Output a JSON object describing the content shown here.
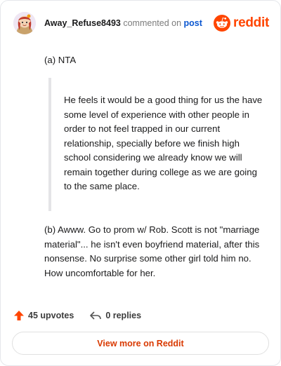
{
  "header": {
    "username": "Away_Refuse8493",
    "verb": "commented on",
    "post_link": "post",
    "brand_name": "reddit"
  },
  "comment": {
    "para_a": "(a) NTA",
    "quote": "He feels it would be a good thing for us the have some level of experience with other people in order to not feel trapped in our current relationship, specially before we finish high school considering we already know we will remain together during college as we are going to the same place.",
    "para_b": "(b) Awww. Go to prom w/ Rob. Scott is not \"marriage material\"... he isn't even boyfriend material, after this nonsense. No surprise some other girl told him no. How uncomfortable for her."
  },
  "footer": {
    "upvotes": "45 upvotes",
    "replies": "0 replies",
    "view_more": "View more on Reddit"
  },
  "colors": {
    "accent": "#ff4500",
    "link": "#0b57d0",
    "button_text": "#d93900"
  },
  "icons": {
    "upvote": "upvote-arrow-icon",
    "reply": "reply-arrow-icon",
    "brand": "reddit-logo-icon"
  }
}
